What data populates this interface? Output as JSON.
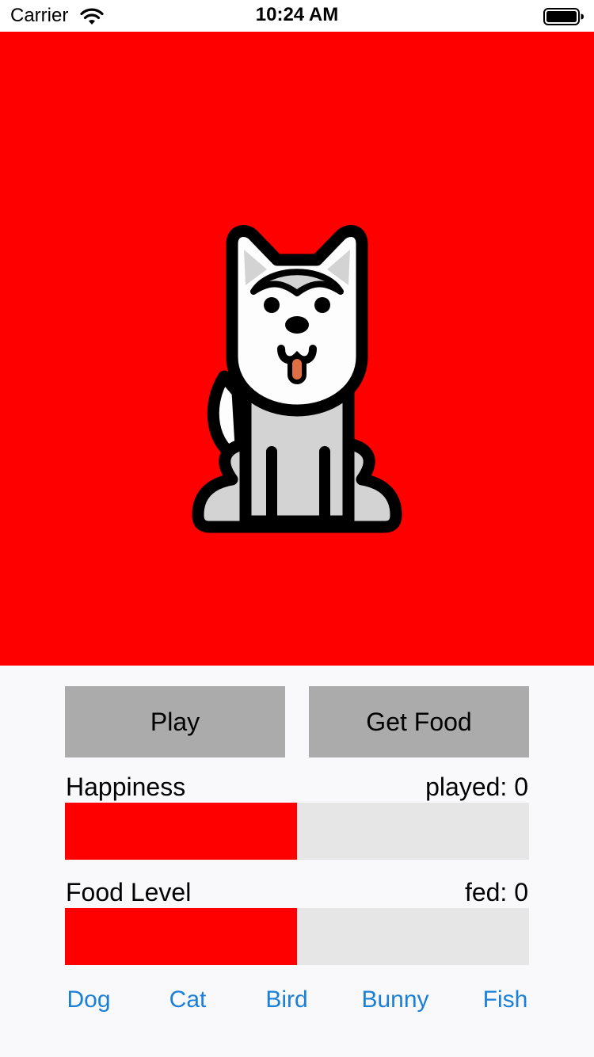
{
  "status_bar": {
    "carrier": "Carrier",
    "time": "10:24 AM",
    "wifi_icon": "wifi-icon",
    "battery_icon": "battery-icon"
  },
  "pet": {
    "background_color": "#ff0000",
    "icon": "husky-dog-icon"
  },
  "buttons": {
    "play_label": "Play",
    "food_label": "Get Food",
    "color": "#ababab"
  },
  "happiness": {
    "label": "Happiness",
    "count_text": "played: 0",
    "level": 0.5,
    "fill_color": "#ff0000"
  },
  "food": {
    "label": "Food Level",
    "count_text": "fed: 0",
    "level": 0.5,
    "fill_color": "#ff0000"
  },
  "pet_tabs": [
    {
      "label": "Dog"
    },
    {
      "label": "Cat"
    },
    {
      "label": "Bird"
    },
    {
      "label": "Bunny"
    },
    {
      "label": "Fish"
    }
  ],
  "colors": {
    "accent": "#1a7fd7",
    "track": "#e6e6e6"
  }
}
